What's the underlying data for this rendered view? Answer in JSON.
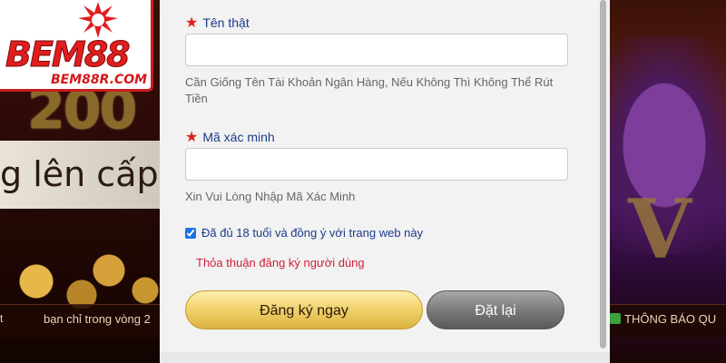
{
  "brand": {
    "logo_text": "BEM88",
    "logo_url": "BEM88R.COM"
  },
  "background": {
    "left_promo_digits": "200",
    "left_promo_text": "g lên cấp",
    "left_ticker_fragment": "t",
    "left_ticker_text": "bạn chỉ trong vòng 2",
    "right_ticker_text": "THÔNG BÁO QU"
  },
  "form": {
    "real_name": {
      "label": "Tên thật",
      "value": "",
      "hint": "Cần Giống Tên Tài Khoản Ngân Hàng, Nếu Không Thì Không Thể Rút Tiền"
    },
    "captcha": {
      "label": "Mã xác minh",
      "value": "",
      "hint": "Xin Vui Lòng Nhập Mã Xác Minh"
    },
    "agreement": {
      "checked": true,
      "label": "Đã đủ 18 tuổi và đồng ý với trang web này"
    },
    "terms_link": "Thỏa thuận đăng ký người dùng",
    "register_button": "Đăng ký ngay",
    "reset_button": "Đặt lại"
  },
  "colors": {
    "required_star": "#e11d1d",
    "label_blue": "#1b3a8a",
    "terms_red": "#d0203a",
    "gold_button": "#f1d370",
    "gray_button": "#7b7b7b"
  }
}
